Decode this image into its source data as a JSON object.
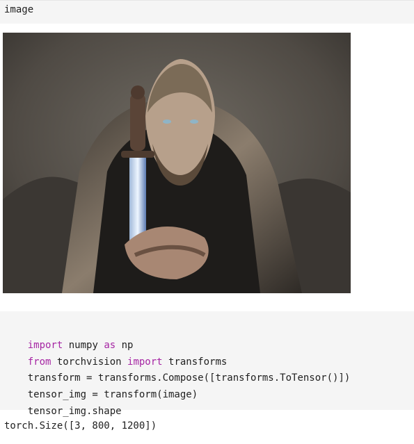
{
  "cells": {
    "first_input": "image",
    "code_lines": [
      [
        {
          "t": "import",
          "kw": true
        },
        {
          "t": " numpy ",
          "kw": false
        },
        {
          "t": "as",
          "kw": true
        },
        {
          "t": " np",
          "kw": false
        }
      ],
      [
        {
          "t": "from",
          "kw": true
        },
        {
          "t": " torchvision ",
          "kw": false
        },
        {
          "t": "import",
          "kw": true
        },
        {
          "t": " transforms",
          "kw": false
        }
      ],
      [
        {
          "t": "transform = transforms.Compose([transforms.ToTensor()])",
          "kw": false
        }
      ],
      [
        {
          "t": "tensor_img = transform(image)",
          "kw": false
        }
      ],
      [
        {
          "t": "tensor_img.shape",
          "kw": false
        }
      ]
    ],
    "output_text": "torch.Size([3, 800, 1200])"
  },
  "colors": {
    "cell_background": "#f5f5f5",
    "keyword": "#a626a4",
    "text": "#1f1f1f"
  }
}
